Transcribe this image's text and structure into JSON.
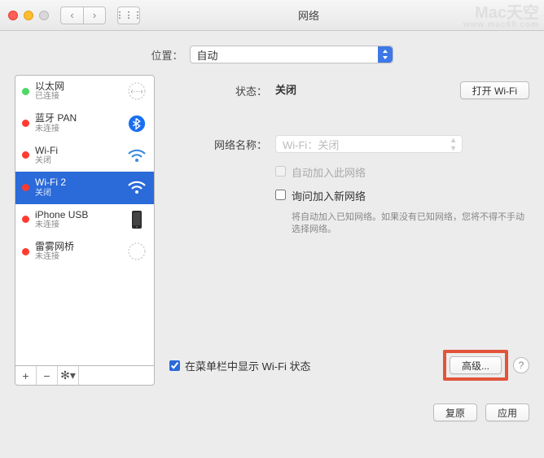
{
  "window": {
    "title": "网络"
  },
  "watermark": {
    "brand": "Mac天空",
    "url": "www.mac69.com"
  },
  "location": {
    "label": "位置：",
    "value": "自动"
  },
  "sidebar": {
    "items": [
      {
        "name": "以太网",
        "sub": "已连接",
        "status": "green",
        "icon": "ethernet"
      },
      {
        "name": "蓝牙 PAN",
        "sub": "未连接",
        "status": "red",
        "icon": "bluetooth"
      },
      {
        "name": "Wi-Fi",
        "sub": "关闭",
        "status": "red",
        "icon": "wifi"
      },
      {
        "name": "Wi-Fi 2",
        "sub": "关闭",
        "status": "red",
        "icon": "wifi-sel",
        "selected": true
      },
      {
        "name": "iPhone USB",
        "sub": "未连接",
        "status": "red",
        "icon": "iphone"
      },
      {
        "name": "雷雾网桥",
        "sub": "未连接",
        "status": "red",
        "icon": "bridge"
      }
    ]
  },
  "main": {
    "status_label": "状态：",
    "status_value": "关闭",
    "toggle_button": "打开 Wi-Fi",
    "network_name_label": "网络名称：",
    "network_name_placeholder": "Wi-Fi：关闭",
    "auto_join_label": "自动加入此网络",
    "ask_join_label": "询问加入新网络",
    "ask_join_help": "将自动加入已知网络。如果没有已知网络，您将不得不手动选择网络。",
    "show_status_label": "在菜单栏中显示 Wi-Fi 状态",
    "advanced_button": "高级...",
    "revert_button": "复原",
    "apply_button": "应用"
  }
}
